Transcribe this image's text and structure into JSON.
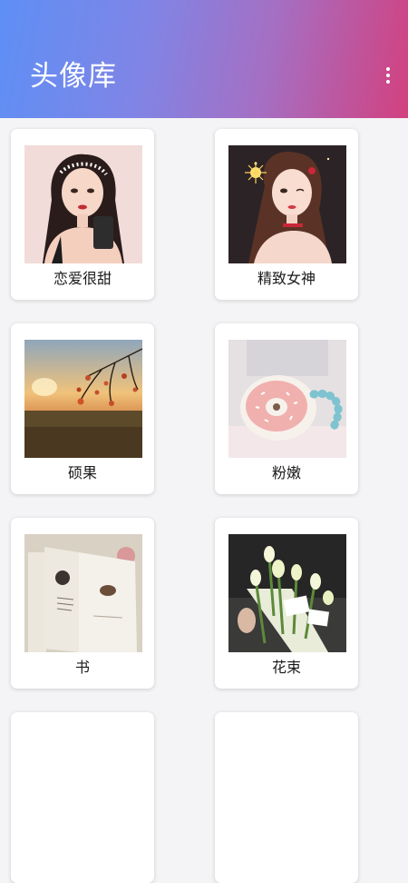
{
  "header": {
    "title": "头像库",
    "menu_icon": "more-vertical-icon"
  },
  "colors": {
    "header_gradient": [
      "#5e8ff5",
      "#a56fc3",
      "#d2417f"
    ],
    "background": "#f4f4f6"
  },
  "avatars": [
    {
      "label": "恋爱很甜"
    },
    {
      "label": "精致女神"
    },
    {
      "label": "硕果"
    },
    {
      "label": "粉嫩"
    },
    {
      "label": "书"
    },
    {
      "label": "花束"
    }
  ]
}
